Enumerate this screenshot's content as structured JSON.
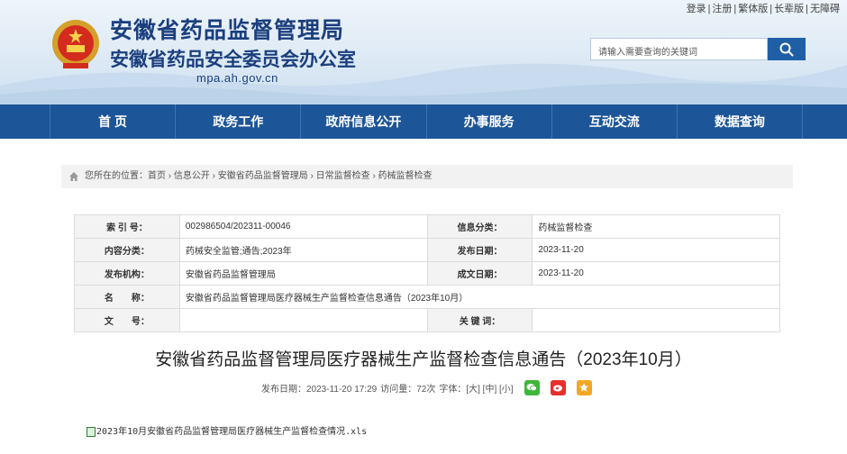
{
  "toplinks": [
    "登录",
    "注册",
    "繁体版",
    "长辈版",
    "无障碍"
  ],
  "header": {
    "title1": "安徽省药品监督管理局",
    "title2": "安徽省药品安全委员会办公室",
    "domain": "mpa.ah.gov.cn",
    "search_placeholder": "请输入需要查询的关键词"
  },
  "nav": [
    "首 页",
    "政务工作",
    "政府信息公开",
    "办事服务",
    "互动交流",
    "数据查询"
  ],
  "breadcrumb": "您所在的位置：首页 › 信息公开 › 安徽省药品监督管理局 › 日常监督检查 › 药械监督检查",
  "info": {
    "index_label": "索 引 号：",
    "index_value": "002986504/202311-00046",
    "category_label": "信息分类：",
    "category_value": "药械监督检查",
    "content_label": "内容分类：",
    "content_value": "药械安全监管;通告;2023年",
    "date_label": "发布日期：",
    "date_value": "2023-11-20",
    "org_label": "发布机构：",
    "org_value": "安徽省药品监督管理局",
    "made_label": "成文日期：",
    "made_value": "2023-11-20",
    "name_label": "名　　称：",
    "name_value": "安徽省药品监督管理局医疗器械生产监督检查信息通告（2023年10月）",
    "doc_label": "文　　号：",
    "doc_value": "",
    "keyword_label": "关 键 词：",
    "keyword_value": ""
  },
  "article": {
    "title": "安徽省药品监督管理局医疗器械生产监督检查信息通告（2023年10月）",
    "publish": "发布日期：2023-11-20 17:29",
    "views": "访问量：72次",
    "font_size": "字体：[大] [中] [小]",
    "attachment": "2023年10月安徽省药品监督管理局医疗器械生产监督检查情况.xls"
  },
  "colors": {
    "brand": "#1b3f7e",
    "nav": "#1c5598",
    "wechat": "#3fb63b",
    "weibo": "#e6302b",
    "favorite": "#f5a623"
  }
}
